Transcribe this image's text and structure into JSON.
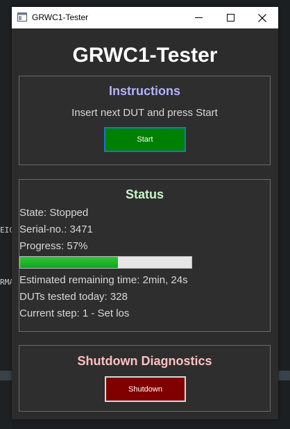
{
  "background": {
    "fragment_1": "EIC",
    "fragment_2": "RMA"
  },
  "window": {
    "title": "GRWC1-Tester",
    "icon": "app-window-icon",
    "controls": [
      "minimize-icon",
      "maximize-icon",
      "close-icon"
    ]
  },
  "app_title": "GRWC1-Tester",
  "instructions": {
    "title": "Instructions",
    "message": "Insert next DUT and press Start",
    "start_label": "Start",
    "title_color": "#b3b3ff",
    "button_color": "#008000"
  },
  "status": {
    "title": "Status",
    "title_color": "#c8f5c8",
    "state": "State: Stopped",
    "serial": "Serial-no.: 3471",
    "progress_text": "Progress: 57%",
    "progress_value": 0.57,
    "remaining": "Estimated remaining time: 2min, 24s",
    "duts_today": "DUTs tested today: 328",
    "current_step": "Current step: 1 - Set los"
  },
  "shutdown": {
    "title": "Shutdown  Diagnostics",
    "title_color": "#ffc0c0",
    "button_label": "Shutdown",
    "button_color": "#800000"
  }
}
